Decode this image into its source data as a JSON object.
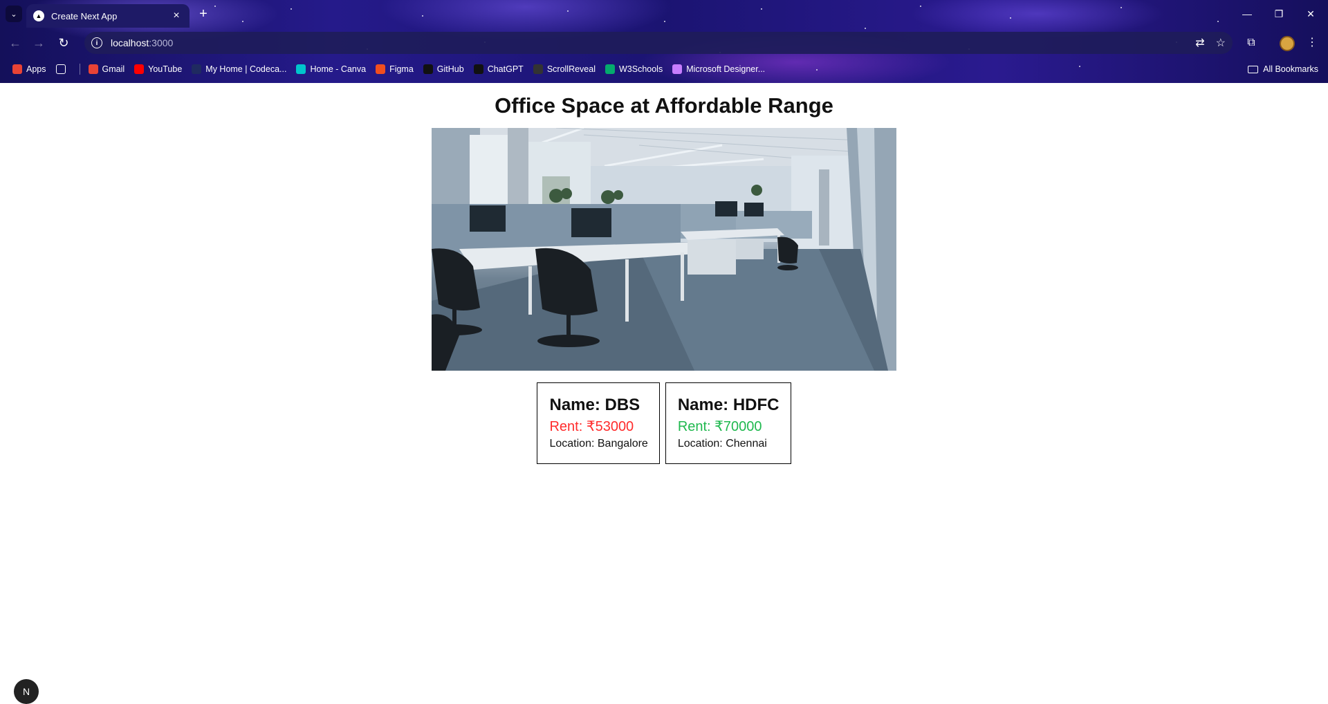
{
  "browser": {
    "tab": {
      "title": "Create Next App"
    },
    "url": {
      "host": "localhost",
      "port": ":3000"
    },
    "bookmarks": [
      {
        "label": "Apps",
        "icon": "apps-grid-icon",
        "color": "#ea4335"
      },
      {
        "label": "",
        "icon": "tab-groups-icon",
        "color": "#ffffff"
      },
      {
        "label": "Gmail",
        "icon": "gmail-icon",
        "color": "#ea4335"
      },
      {
        "label": "YouTube",
        "icon": "youtube-icon",
        "color": "#ff0000"
      },
      {
        "label": "My Home | Codeca...",
        "icon": "codecademy-icon",
        "color": "#1f2a60"
      },
      {
        "label": "Home - Canva",
        "icon": "canva-icon",
        "color": "#00c4cc"
      },
      {
        "label": "Figma",
        "icon": "figma-icon",
        "color": "#f24e1e"
      },
      {
        "label": "GitHub",
        "icon": "github-icon",
        "color": "#111111"
      },
      {
        "label": "ChatGPT",
        "icon": "chatgpt-icon",
        "color": "#111111"
      },
      {
        "label": "ScrollReveal",
        "icon": "scrollreveal-icon",
        "color": "#333333"
      },
      {
        "label": "W3Schools",
        "icon": "w3schools-icon",
        "color": "#04aa6d"
      },
      {
        "label": "Microsoft Designer...",
        "icon": "designer-icon",
        "color": "#c77dff"
      }
    ],
    "all_bookmarks": "All Bookmarks"
  },
  "page": {
    "title": "Office Space at Affordable Range",
    "image": {
      "alt": "office-interior-photo"
    },
    "offices": [
      {
        "name": "Name: DBS",
        "rent": "Rent: ₹53000",
        "location": "Location: Bangalore",
        "rent_color": "#ff2b2b"
      },
      {
        "name": "Name: HDFC",
        "rent": "Rent: ₹70000",
        "location": "Location: Chennai",
        "rent_color": "#1fb84e"
      }
    ],
    "dev_badge": "N"
  }
}
